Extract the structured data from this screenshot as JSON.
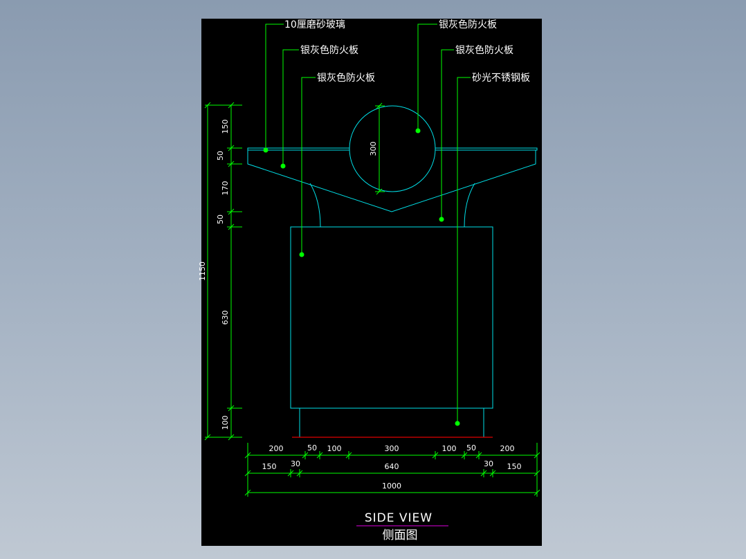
{
  "drawing": {
    "title_en": "SIDE VIEW",
    "title_cn": "侧面图",
    "colors": {
      "outline": "#00e0e8",
      "dimension": "#00ff00",
      "leader_dot": "#00ff00",
      "text": "#ffffff",
      "title_underline": "#e000e0",
      "ground_line": "#e00000",
      "background": "#000000"
    }
  },
  "callouts": [
    {
      "text": "10厘磨砂玻璃"
    },
    {
      "text": "银灰色防火板"
    },
    {
      "text": "银灰色防火板"
    },
    {
      "text": "银灰色防火板"
    },
    {
      "text": "银灰色防火板"
    },
    {
      "text": "砂光不锈钢板"
    }
  ],
  "dims_vertical": {
    "segments": [
      "150",
      "50",
      "170",
      "50",
      "630",
      "100"
    ],
    "total": "1150",
    "circle": "300"
  },
  "dims_horizontal": {
    "row1": [
      "200",
      "50",
      "100",
      "300",
      "100",
      "50",
      "200"
    ],
    "row2": [
      "150",
      "30",
      "640",
      "30",
      "150"
    ],
    "row3": [
      "1000"
    ]
  }
}
